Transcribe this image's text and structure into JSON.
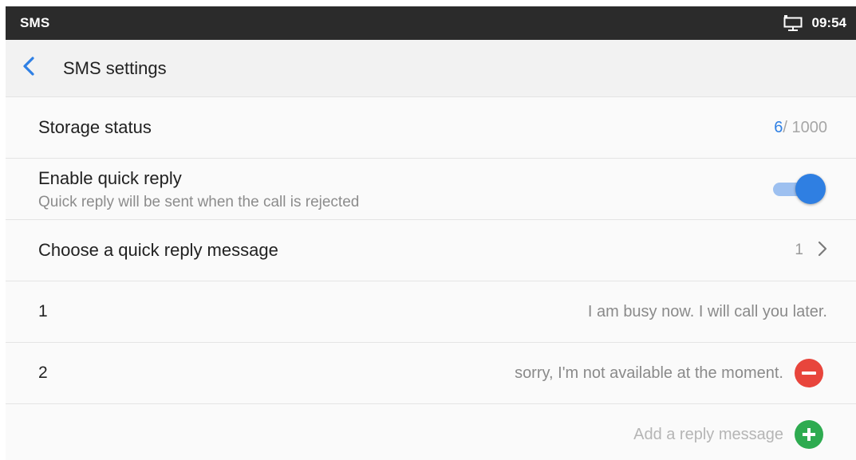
{
  "status_bar": {
    "app_name": "SMS",
    "time": "09:54",
    "icon": "network-icon"
  },
  "header": {
    "back_icon": "chevron-left-icon",
    "title": "SMS settings"
  },
  "settings": {
    "storage": {
      "label": "Storage status",
      "used": "6",
      "total": "/ 1000"
    },
    "quick_reply": {
      "label": "Enable quick reply",
      "description": "Quick reply will be sent when the call is rejected",
      "enabled": true
    },
    "choose_message": {
      "label": "Choose a quick reply message",
      "value": "1",
      "icon": "chevron-right-icon"
    },
    "messages": [
      {
        "index": "1",
        "text": "I am busy now. I will call you later."
      },
      {
        "index": "2",
        "text": "sorry, I'm not available at the moment.",
        "action_icon": "remove-icon"
      }
    ],
    "add_message": {
      "label": "Add a reply message",
      "icon": "add-icon"
    }
  },
  "colors": {
    "accent": "#2f7fe2",
    "toggle_track": "#9dc0f0",
    "remove": "#e8453c",
    "add": "#2eab50",
    "status_bar_bg": "#2b2b2b"
  }
}
